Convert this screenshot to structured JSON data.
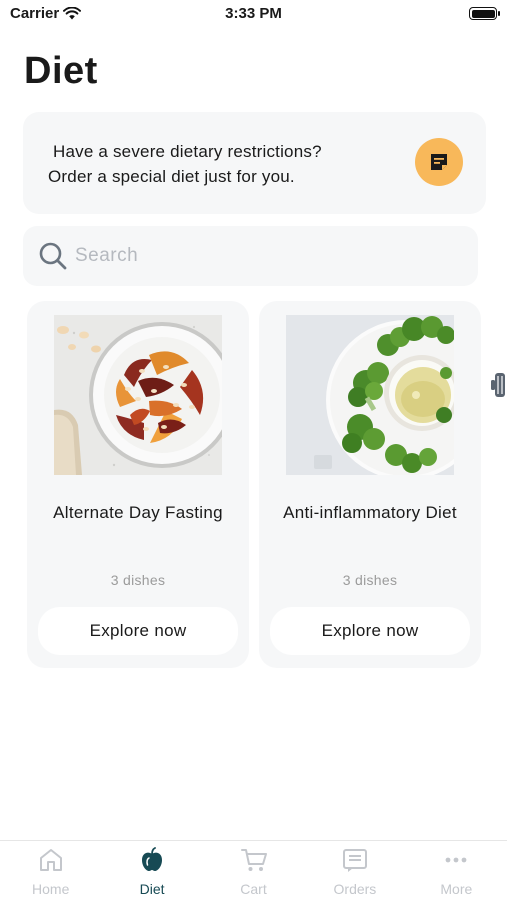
{
  "status_bar": {
    "carrier": "Carrier",
    "time": "3:33 PM"
  },
  "page": {
    "title": "Diet"
  },
  "promo": {
    "line1": "Have a severe dietary restrictions?",
    "line2": "Order a special diet just for you.",
    "icon": "note-icon",
    "accent": "#f8b85a"
  },
  "search": {
    "placeholder": "Search",
    "value": ""
  },
  "diets": [
    {
      "title": "Alternate Day Fasting",
      "count": "3 dishes",
      "button": "Explore now"
    },
    {
      "title": "Anti-inflammatory Diet",
      "count": "3 dishes",
      "button": "Explore now"
    }
  ],
  "tabs": [
    {
      "label": "Home",
      "icon": "home-icon",
      "active": false
    },
    {
      "label": "Diet",
      "icon": "apple-icon",
      "active": true
    },
    {
      "label": "Cart",
      "icon": "cart-icon",
      "active": false
    },
    {
      "label": "Orders",
      "icon": "orders-icon",
      "active": false
    },
    {
      "label": "More",
      "icon": "more-icon",
      "active": false
    }
  ],
  "colors": {
    "active_tab": "#174a54",
    "inactive_tab": "#c4c7cc",
    "card_bg": "#f6f7f8"
  }
}
